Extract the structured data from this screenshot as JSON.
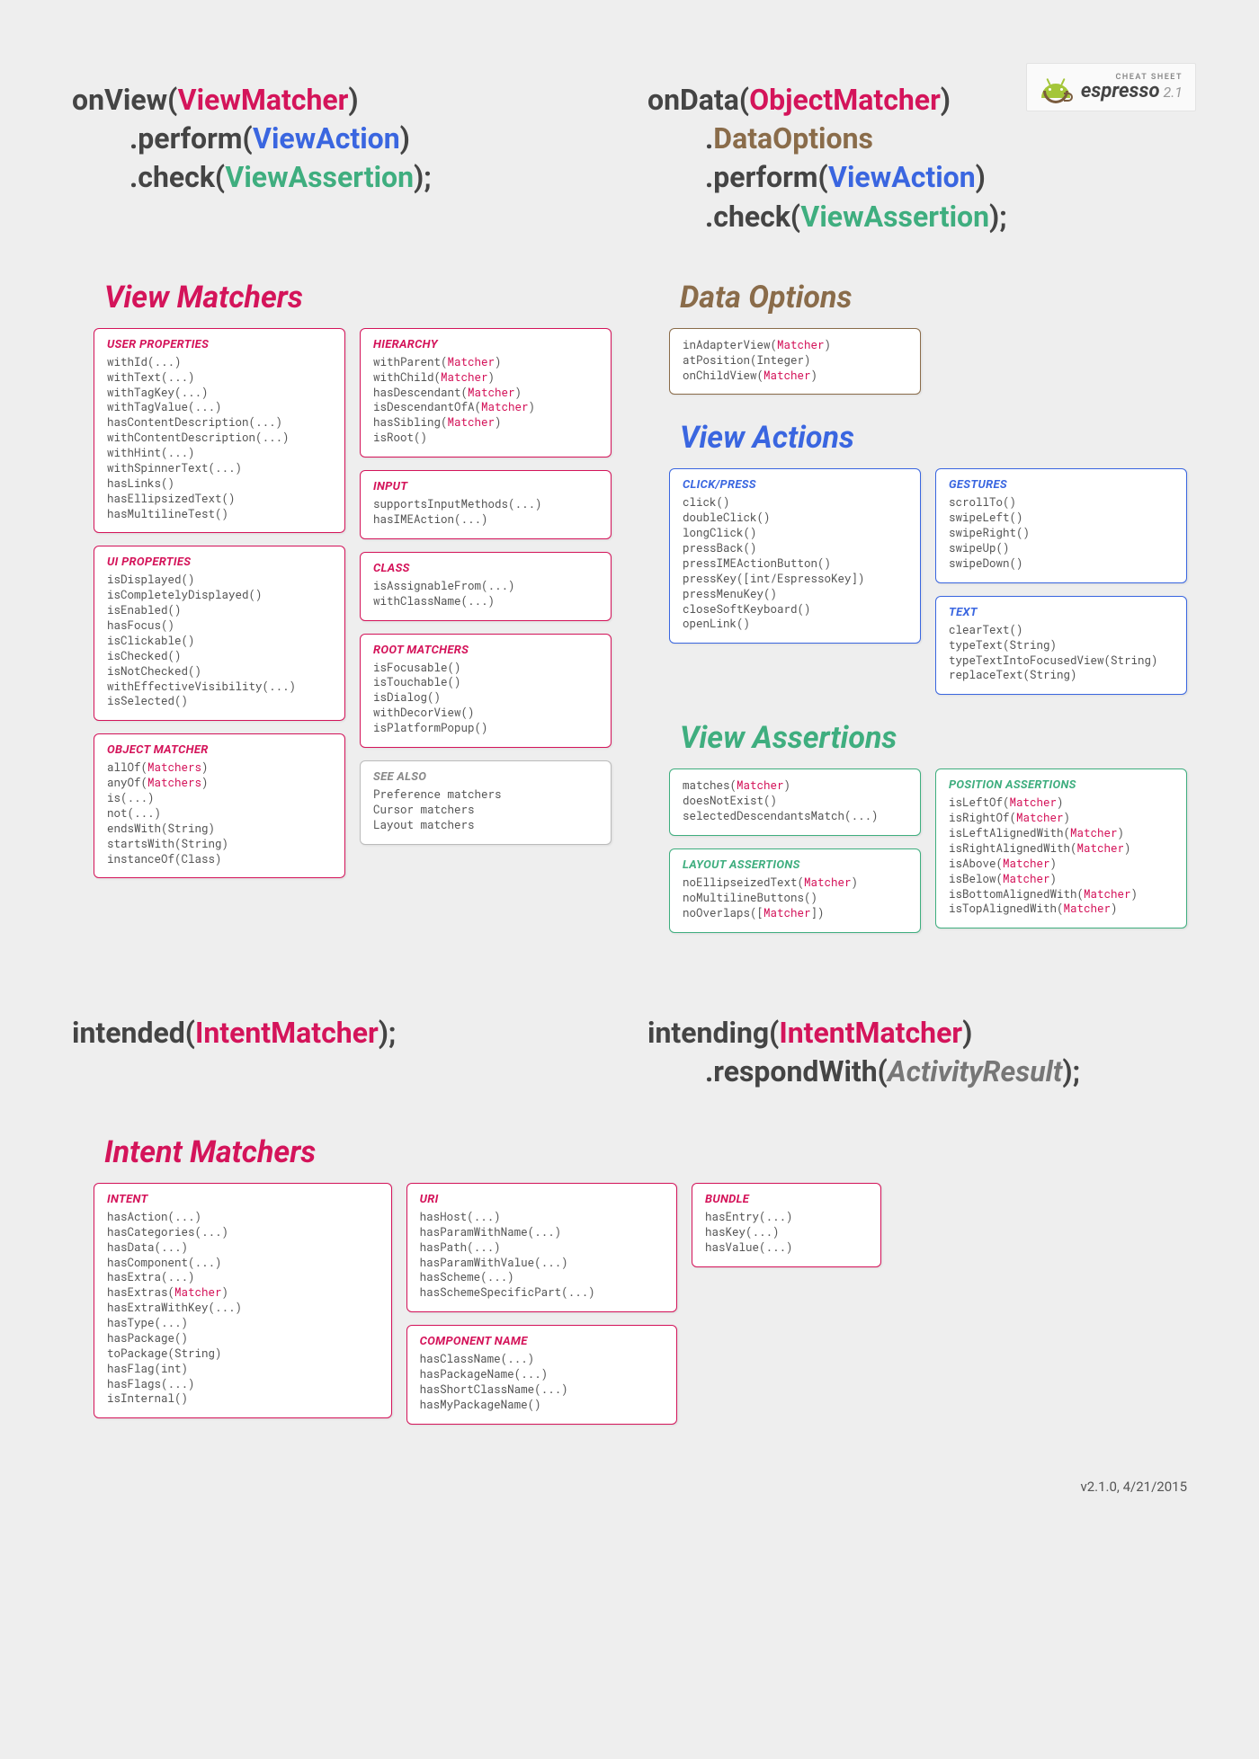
{
  "logo": {
    "cheat": "CHEAT SHEET",
    "name": "espresso",
    "ver": "2.1"
  },
  "sig_onview": {
    "pre": "onView(",
    "arg": "ViewMatcher",
    "post": ")",
    "l2a": ".perform(",
    "l2b": "ViewAction",
    "l2c": ")",
    "l3a": ".check(",
    "l3b": "ViewAssertion",
    "l3c": ");"
  },
  "sig_ondata": {
    "pre": "onData(",
    "arg": "ObjectMatcher",
    "post": ")",
    "l2": ".",
    "l2b": "DataOptions",
    "l3a": ".perform(",
    "l3b": "ViewAction",
    "l3c": ")",
    "l4a": ".check(",
    "l4b": "ViewAssertion",
    "l4c": ");"
  },
  "headings": {
    "vm": "View Matchers",
    "do": "Data Options",
    "va": "View Actions",
    "vas": "View Assertions",
    "im": "Intent Matchers"
  },
  "vm": {
    "user_props": {
      "title": "USER PROPERTIES",
      "body": "withId(...)\nwithText(...)\nwithTagKey(...)\nwithTagValue(...)\nhasContentDescription(...)\nwithContentDescription(...)\nwithHint(...)\nwithSpinnerText(...)\nhasLinks()\nhasEllipsizedText()\nhasMultilineTest()"
    },
    "ui_props": {
      "title": "UI PROPERTIES",
      "body": "isDisplayed()\nisCompletelyDisplayed()\nisEnabled()\nhasFocus()\nisClickable()\nisChecked()\nisNotChecked()\nwithEffectiveVisibility(...)\nisSelected()"
    },
    "obj": {
      "title": "OBJECT MATCHER",
      "body_html": "allOf(<span class='p'>Matchers</span>)\nanyOf(<span class='p'>Matchers</span>)\nis(...)\nnot(...)\nendsWith(String)\nstartsWith(String)\ninstanceOf(Class)"
    },
    "hier": {
      "title": "HIERARCHY",
      "body_html": "withParent(<span class='p'>Matcher</span>)\nwithChild(<span class='p'>Matcher</span>)\nhasDescendant(<span class='p'>Matcher</span>)\nisDescendantOfA(<span class='p'>Matcher</span>)\nhasSibling(<span class='p'>Matcher</span>)\nisRoot()"
    },
    "input": {
      "title": "INPUT",
      "body": "supportsInputMethods(...)\nhasIMEAction(...)"
    },
    "class": {
      "title": "CLASS",
      "body": "isAssignableFrom(...)\nwithClassName(...)"
    },
    "root": {
      "title": "ROOT MATCHERS",
      "body": "isFocusable()\nisTouchable()\nisDialog()\nwithDecorView()\nisPlatformPopup()"
    },
    "see": {
      "title": "SEE ALSO",
      "body": "Preference matchers\nCursor matchers\nLayout matchers"
    }
  },
  "dataopt": {
    "body_html": "inAdapterView(<span class='p'>Matcher</span>)\natPosition(Integer)\nonChildView(<span class='p'>Matcher</span>)"
  },
  "va": {
    "click": {
      "title": "CLICK/PRESS",
      "body": "click()\ndoubleClick()\nlongClick()\npressBack()\npressIMEActionButton()\npressKey([int/EspressoKey])\npressMenuKey()\ncloseSoftKeyboard()\nopenLink()"
    },
    "gest": {
      "title": "GESTURES",
      "body": "scrollTo()\nswipeLeft()\nswipeRight()\nswipeUp()\nswipeDown()"
    },
    "text": {
      "title": "TEXT",
      "body": "clearText()\ntypeText(String)\ntypeTextIntoFocusedView(String)\nreplaceText(String)"
    }
  },
  "vas": {
    "main": {
      "body_html": "matches(<span class='p'>Matcher</span>)\ndoesNotExist()\nselectedDescendantsMatch(...)"
    },
    "layout": {
      "title": "LAYOUT ASSERTIONS",
      "body_html": "noEllipseizedText(<span class='p'>Matcher</span>)\nnoMultilineButtons()\nnoOverlaps([<span class='p'>Matcher</span>])"
    },
    "pos": {
      "title": "POSITION ASSERTIONS",
      "body_html": "isLeftOf(<span class='p'>Matcher</span>)\nisRightOf(<span class='p'>Matcher</span>)\nisLeftAlignedWith(<span class='p'>Matcher</span>)\nisRightAlignedWith(<span class='p'>Matcher</span>)\nisAbove(<span class='p'>Matcher</span>)\nisBelow(<span class='p'>Matcher</span>)\nisBottomAlignedWith(<span class='p'>Matcher</span>)\nisTopAlignedWith(<span class='p'>Matcher</span>)"
    }
  },
  "sig_intended": {
    "pre": "intended(",
    "arg": "IntentMatcher",
    "post": ");"
  },
  "sig_intending": {
    "pre": "intending(",
    "arg": "IntentMatcher",
    "post": ")",
    "l2a": ".respondWith(",
    "l2b": "ActivityResult",
    "l2c": ");"
  },
  "im": {
    "intent": {
      "title": "INTENT",
      "body_html": "hasAction(...)\nhasCategories(...)\nhasData(...)\nhasComponent(...)\nhasExtra(...)\nhasExtras(<span class='p'>Matcher</span>)\nhasExtraWithKey(...)\nhasType(...)\nhasPackage()\ntoPackage(String)\nhasFlag(int)\nhasFlags(...)\nisInternal()"
    },
    "uri": {
      "title": "URI",
      "body": "hasHost(...)\nhasParamWithName(...)\nhasPath(...)\nhasParamWithValue(...)\nhasScheme(...)\nhasSchemeSpecificPart(...)"
    },
    "comp": {
      "title": "COMPONENT NAME",
      "body": "hasClassName(...)\nhasPackageName(...)\nhasShortClassName(...)\nhasMyPackageName()"
    },
    "bundle": {
      "title": "BUNDLE",
      "body": "hasEntry(...)\nhasKey(...)\nhasValue(...)"
    }
  },
  "footer": "v2.1.0, 4/21/2015"
}
